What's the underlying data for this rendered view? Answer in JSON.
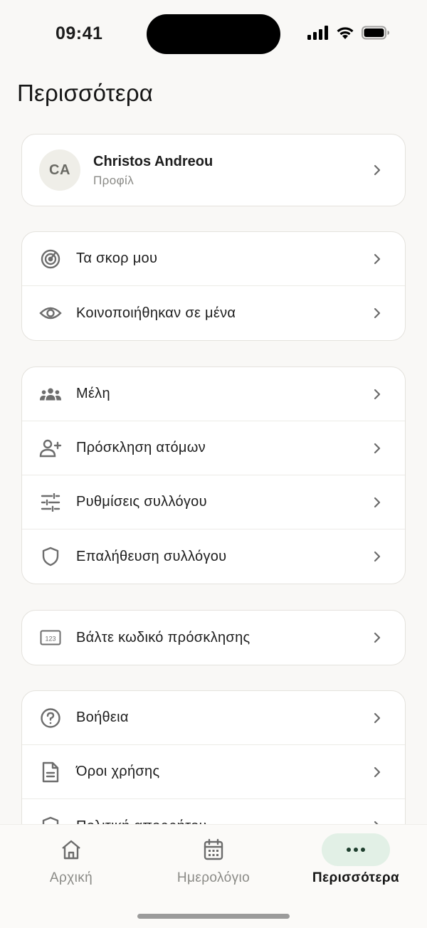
{
  "status_bar": {
    "time": "09:41"
  },
  "page_title": "Περισσότερα",
  "profile": {
    "initials": "CA",
    "name": "Christos Andreou",
    "subtitle": "Προφίλ"
  },
  "sections": [
    [
      {
        "icon": "target-icon",
        "label": "Τα σκορ μου"
      },
      {
        "icon": "eye-icon",
        "label": "Κοινοποιήθηκαν σε μένα"
      }
    ],
    [
      {
        "icon": "group-icon",
        "label": "Μέλη"
      },
      {
        "icon": "add-person-icon",
        "label": "Πρόσκληση ατόμων"
      },
      {
        "icon": "sliders-icon",
        "label": "Ρυθμίσεις συλλόγου"
      },
      {
        "icon": "shield-icon",
        "label": "Επαλήθευση συλλόγου"
      }
    ],
    [
      {
        "icon": "keypad-123-icon",
        "label": "Βάλτε κωδικό πρόσκλησης"
      }
    ],
    [
      {
        "icon": "help-circle-icon",
        "label": "Βοήθεια"
      },
      {
        "icon": "document-icon",
        "label": "Όροι χρήσης"
      },
      {
        "icon": "shield-lock-icon",
        "label": "Πολιτική απορρήτου"
      }
    ]
  ],
  "tabs": [
    {
      "icon": "home-icon",
      "label": "Αρχική",
      "active": false
    },
    {
      "icon": "calendar-icon",
      "label": "Ημερολόγιο",
      "active": false
    },
    {
      "icon": "more-dots-icon",
      "label": "Περισσότερα",
      "active": true
    }
  ],
  "colors": {
    "background": "#f9f8f6",
    "active_tab_pill": "#e2f0e6",
    "card_border": "#e4e2dd"
  }
}
